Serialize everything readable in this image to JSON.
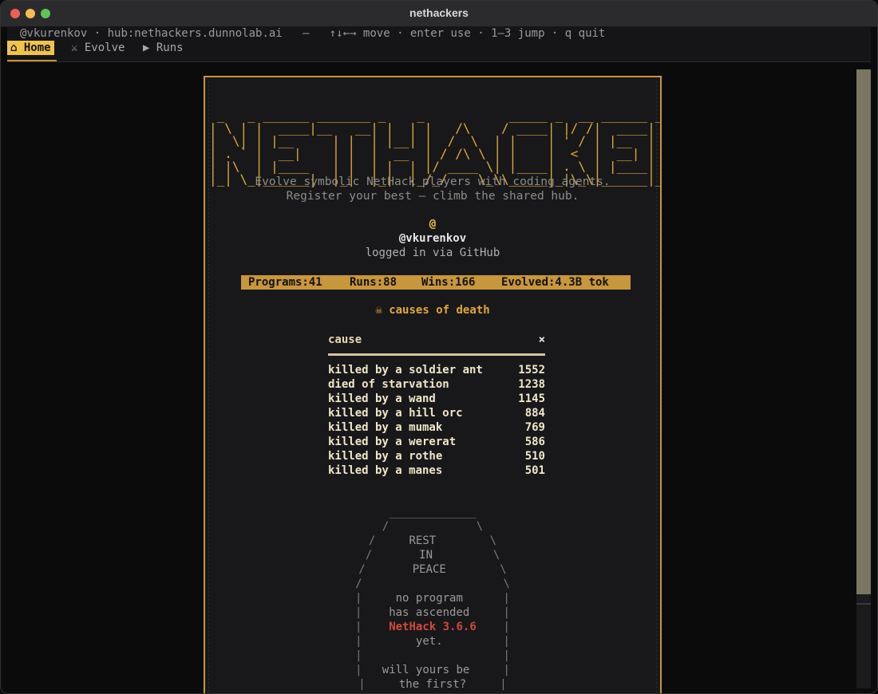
{
  "window": {
    "title": "nethackers"
  },
  "statusline": {
    "user": "@vkurenkov",
    "hub": "hub:nethackers.dunnolab.ai",
    "dash": "—",
    "help": "↑↓←→ move · enter use · 1–3 jump · q quit"
  },
  "tabs": [
    {
      "icon": "⌂",
      "label": "Home"
    },
    {
      "icon": "⚔",
      "label": "Evolve"
    },
    {
      "icon": "▶",
      "label": "Runs"
    }
  ],
  "logo_art": [
    " _   _ ______ _______ _    _           _____ _  __ ______ _____   _____ ",
    "| \\ | |  ____|__   __| |  | |   /\\    / ____| |/ /|  ____|  __ \\ / ____|",
    "|  \\| | |__     | |  | |__| |  /  \\  | |    | ' / | |__  | |__) | (___  ",
    "| . ` |  __|    | |  |  __  | / /\\ \\ | |    |  <  |  __| |  _  / \\___ \\ ",
    "| |\\  | |____   | |  | |  | |/ ____ \\| |____| . \\ | |____| | \\ \\ ____) |",
    "|_| \\_|______|  |_|  |_|  |_/_/    \\_\\\\_____|_|\\_\\|______|_|  \\_\\_____/ "
  ],
  "tagline": [
    "Evolve symbolic NetHack players with coding agents.",
    "Register your best — climb the shared hub."
  ],
  "profile": {
    "avatar": "@",
    "handle": "@vkurenkov",
    "login_note": "logged in via GitHub"
  },
  "stats": {
    "programs": "Programs:41",
    "runs": "Runs:88",
    "wins": "Wins:166",
    "evolved": "Evolved:4.3B tok"
  },
  "causes_of_death": {
    "title": "☠ causes of death",
    "header_cause": "cause",
    "header_close": "×",
    "rows": [
      {
        "cause": "killed by a soldier ant",
        "count": "1552"
      },
      {
        "cause": "died of starvation",
        "count": "1238"
      },
      {
        "cause": "killed by a wand",
        "count": "1145"
      },
      {
        "cause": "killed by a hill orc",
        "count": "884"
      },
      {
        "cause": "killed by a mumak",
        "count": "769"
      },
      {
        "cause": "killed by a wererat",
        "count": "586"
      },
      {
        "cause": "killed by a rothe",
        "count": "510"
      },
      {
        "cause": "killed by a manes",
        "count": "501"
      }
    ]
  },
  "tombstone": {
    "rest": "REST",
    "in": "IN",
    "peace": "PEACE",
    "line1": "no program",
    "line2": "has ascended",
    "version": "NetHack 3.6.6",
    "line3": "yet.",
    "line4": "will yours be",
    "line5": "the first?"
  },
  "colors": {
    "accent": "#f0c34a",
    "border": "#c8963b",
    "danger": "#d1493a",
    "background": "#0b0b0c",
    "panel": "#18181b"
  }
}
